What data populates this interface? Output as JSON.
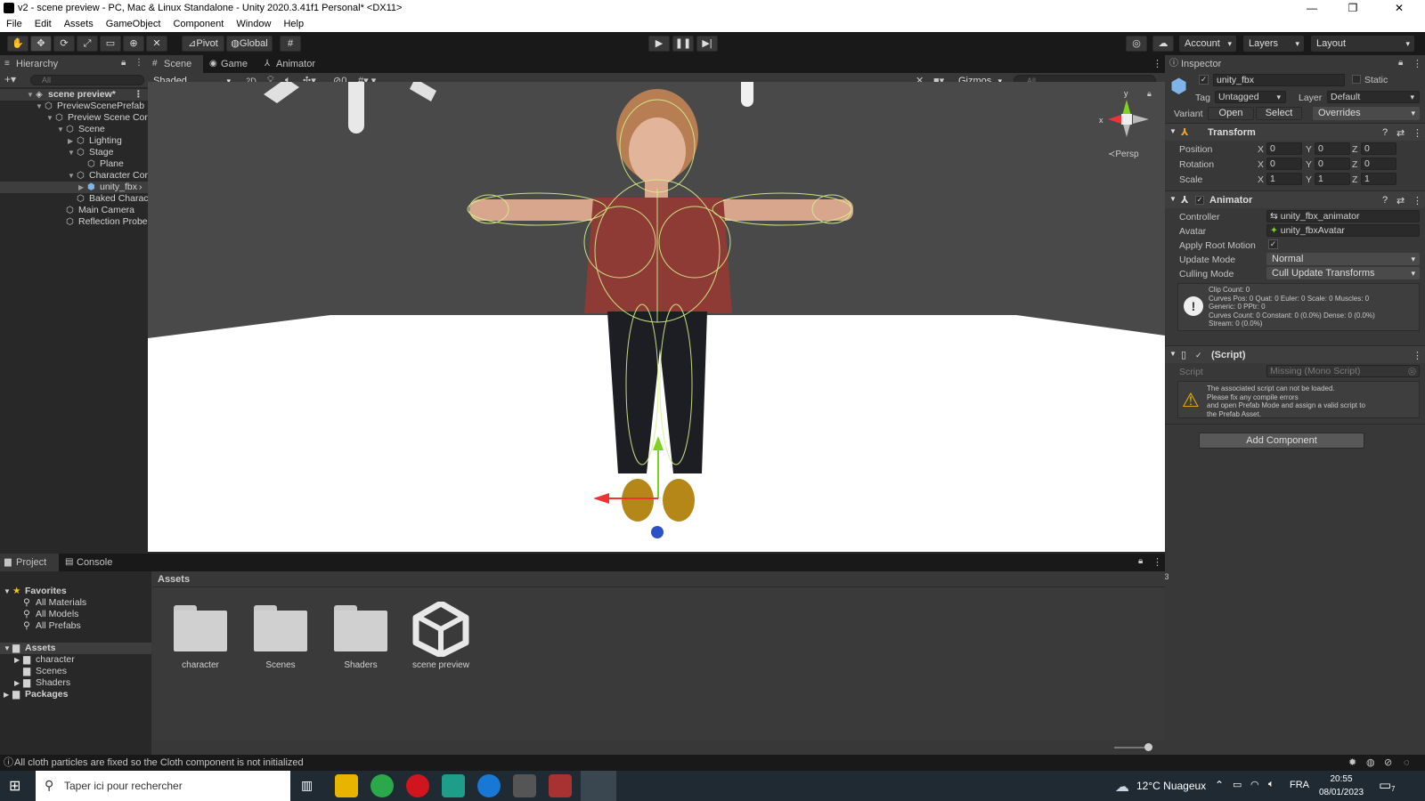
{
  "window": {
    "title": "v2 - scene preview - PC, Mac & Linux Standalone - Unity 2020.3.41f1 Personal* <DX11>",
    "minimize": "—",
    "maximize": "❐",
    "close": "✕"
  },
  "menu": [
    "File",
    "Edit",
    "Assets",
    "GameObject",
    "Component",
    "Window",
    "Help"
  ],
  "toolbar": {
    "pivot": "Pivot",
    "global": "Global",
    "account": "Account",
    "layers": "Layers",
    "layout": "Layout"
  },
  "hierarchy": {
    "tab": "Hierarchy",
    "search_placeholder": "All",
    "items": [
      {
        "label": "scene preview*",
        "depth": 0
      },
      {
        "label": "PreviewScenePrefab",
        "depth": 1
      },
      {
        "label": "Preview Scene Cor",
        "depth": 2
      },
      {
        "label": "Scene",
        "depth": 3
      },
      {
        "label": "Lighting",
        "depth": 4
      },
      {
        "label": "Stage",
        "depth": 4
      },
      {
        "label": "Plane",
        "depth": 5
      },
      {
        "label": "Character Cor",
        "depth": 4
      },
      {
        "label": "unity_fbx",
        "depth": 5
      },
      {
        "label": "Baked Charac",
        "depth": 5
      },
      {
        "label": "Main Camera",
        "depth": 3
      },
      {
        "label": "Reflection Probe",
        "depth": 3
      }
    ]
  },
  "scene": {
    "tabs": [
      "Scene",
      "Game",
      "Animator"
    ],
    "shading": "Shaded",
    "mode2d": "2D",
    "hidden_count": "0",
    "gizmos": "Gizmos",
    "search_placeholder": "All",
    "persp": "Persp"
  },
  "inspector": {
    "tab": "Inspector",
    "object_name": "unity_fbx",
    "static_label": "Static",
    "tag_label": "Tag",
    "tag_value": "Untagged",
    "layer_label": "Layer",
    "layer_value": "Default",
    "variant_label": "Variant",
    "open": "Open",
    "select": "Select",
    "overrides": "Overrides",
    "transform": {
      "title": "Transform",
      "position": {
        "label": "Position",
        "x": "0",
        "y": "0",
        "z": "0"
      },
      "rotation": {
        "label": "Rotation",
        "x": "0",
        "y": "0",
        "z": "0"
      },
      "scale": {
        "label": "Scale",
        "x": "1",
        "y": "1",
        "z": "1"
      }
    },
    "axis": {
      "x": "X",
      "y": "Y",
      "z": "Z"
    },
    "animator": {
      "title": "Animator",
      "controller_label": "Controller",
      "controller_value": "unity_fbx_animator",
      "avatar_label": "Avatar",
      "avatar_value": "unity_fbxAvatar",
      "root_motion_label": "Apply Root Motion",
      "update_mode_label": "Update Mode",
      "update_mode_value": "Normal",
      "culling_mode_label": "Culling Mode",
      "culling_mode_value": "Cull Update Transforms",
      "info": [
        "Clip Count: 0",
        "Curves Pos: 0 Quat: 0 Euler: 0 Scale: 0 Muscles: 0",
        "Generic: 0 PPtr: 0",
        "Curves Count: 0 Constant: 0 (0.0%) Dense: 0 (0.0%)",
        "Stream: 0 (0.0%)"
      ]
    },
    "script": {
      "title": "(Script)",
      "label": "Script",
      "value": "Missing (Mono Script)",
      "warning": [
        "The associated script can not be loaded.",
        "Please fix any compile errors",
        "and open Prefab Mode and assign a valid script to",
        "the Prefab Asset."
      ]
    },
    "add_component": "Add Component"
  },
  "project": {
    "tabs": [
      "Project",
      "Console"
    ],
    "hidden_count": "3",
    "favorites": {
      "label": "Favorites",
      "items": [
        "All Materials",
        "All Models",
        "All Prefabs"
      ]
    },
    "assets_label": "Assets",
    "asset_folders": [
      "character",
      "Scenes",
      "Shaders"
    ],
    "packages_label": "Packages",
    "breadcrumb": "Assets",
    "grid": [
      {
        "label": "character",
        "kind": "folder"
      },
      {
        "label": "Scenes",
        "kind": "folder"
      },
      {
        "label": "Shaders",
        "kind": "folder"
      },
      {
        "label": "scene preview",
        "kind": "unity-scene"
      }
    ]
  },
  "status": {
    "message": "All cloth particles are fixed so the Cloth component is not initialized"
  },
  "taskbar": {
    "search_placeholder": "Taper ici pour rechercher",
    "weather": "12°C  Nuageux",
    "lang": "FRA",
    "time": "20:55",
    "date": "08/01/2023",
    "notifications": "7"
  },
  "colors": {
    "editor_bg": "#282828",
    "panel_bg": "#383838",
    "toolbar_bg": "#191919",
    "accent_blue": "#3a79bb",
    "floor": "#ffffff",
    "backdrop": "#494949"
  }
}
